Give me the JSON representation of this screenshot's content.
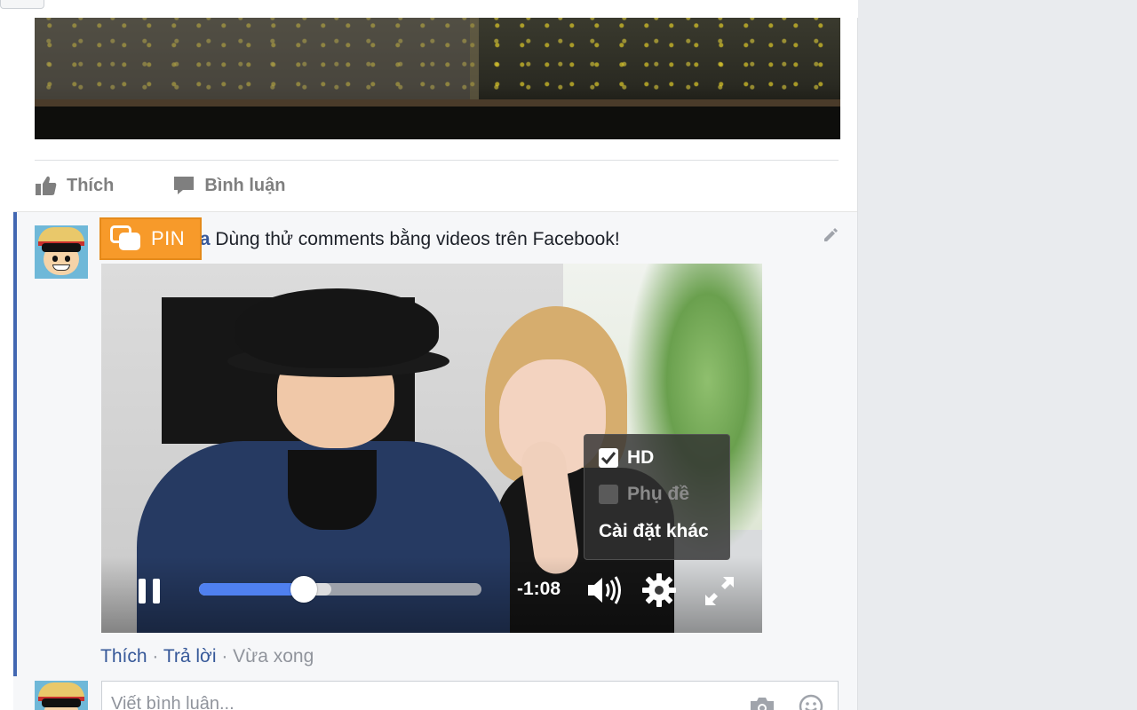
{
  "post": {
    "actions": [
      {
        "label": "Thích",
        "icon": "like-icon"
      },
      {
        "label": "Bình luận",
        "icon": "comment-icon"
      }
    ]
  },
  "comment": {
    "author": "ha",
    "text": " Dùng thử comments bằng videos trên Facebook!",
    "pin_label": "PIN",
    "like_label": "Thích",
    "separator": " · ",
    "reply_label": "Trả lời",
    "timestamp": "Vừa xong"
  },
  "video": {
    "time_remaining": "-1:08",
    "progress": 0.37,
    "buffered": 0.47,
    "settings_menu": {
      "hd_label": "HD",
      "hd_checked": true,
      "subtitles_label": "Phụ đề",
      "subtitles_checked": false,
      "more_settings_label": "Cài đặt khác"
    }
  },
  "reply_box": {
    "placeholder": "Viết bình luận..."
  },
  "colors": {
    "facebook_blue": "#4267b2",
    "link": "#365899",
    "pin_orange": "#f79a2a",
    "progress_blue": "#4f80f0"
  }
}
